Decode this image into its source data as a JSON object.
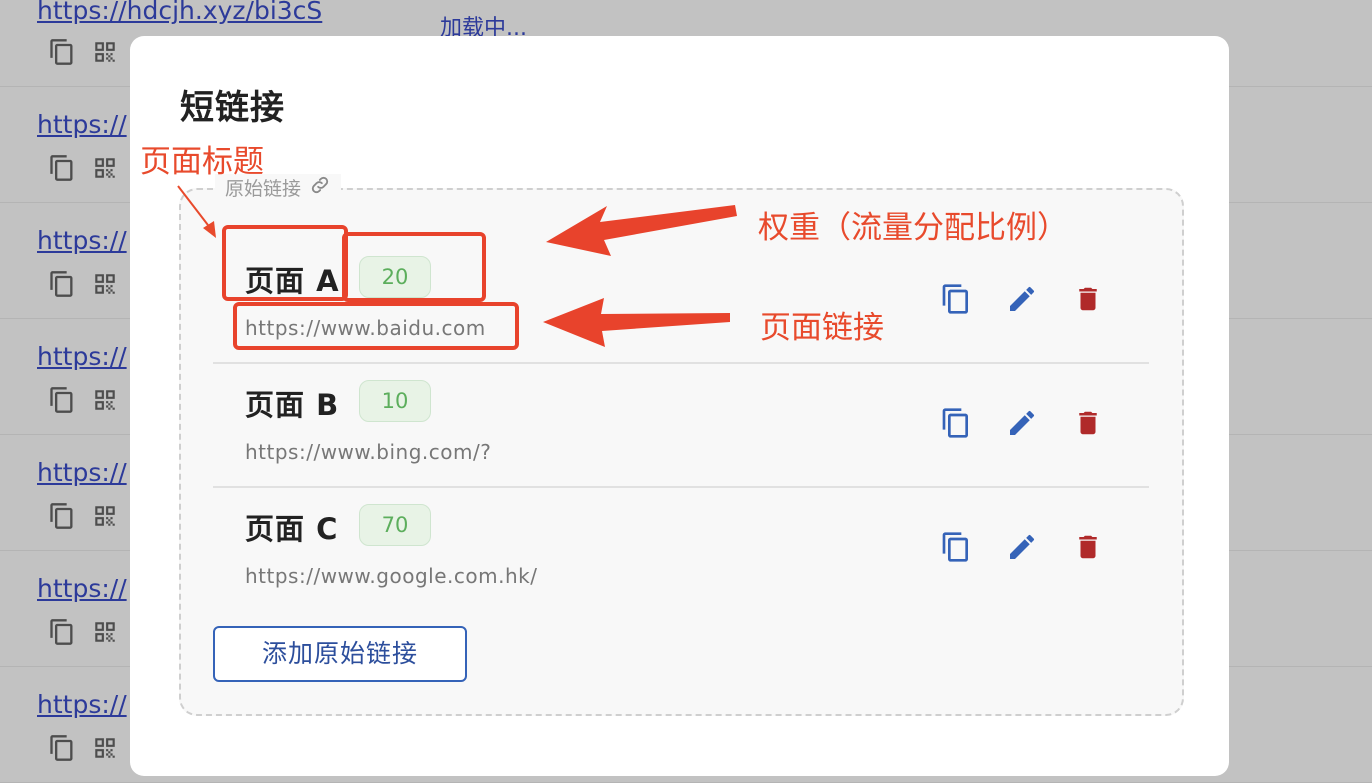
{
  "background": {
    "loading_text": "加载中...",
    "rows": [
      {
        "link": "https://hdcjh.xyz/bi3cS"
      },
      {
        "link": "https://"
      },
      {
        "link": "https://"
      },
      {
        "link": "https://"
      },
      {
        "link": "https://"
      },
      {
        "link": "https://"
      },
      {
        "link": "https://"
      }
    ]
  },
  "modal": {
    "title": "短链接",
    "fieldset_legend": "原始链接",
    "items": [
      {
        "title": "页面 A",
        "weight": "20",
        "url": "https://www.baidu.com"
      },
      {
        "title": "页面 B",
        "weight": "10",
        "url": "https://www.bing.com/?"
      },
      {
        "title": "页面 C",
        "weight": "70",
        "url": "https://www.google.com.hk/"
      }
    ],
    "add_button": "添加原始链接"
  },
  "annotations": {
    "page_title": "页面标题",
    "weight": "权重（流量分配比例）",
    "page_link": "页面链接"
  },
  "colors": {
    "accent_blue": "#3563b8",
    "delete_red": "#b02a2a",
    "weight_green": "#5cae5c",
    "annotation_red": "#e84a2c"
  }
}
